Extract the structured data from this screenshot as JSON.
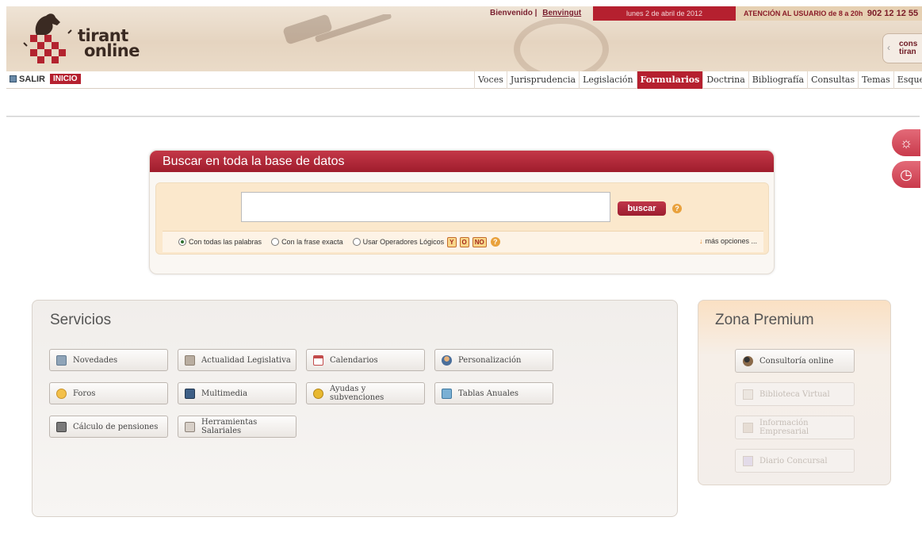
{
  "header": {
    "logo_lines": [
      "tirant",
      "online"
    ],
    "welcome_label": "Bienvenido |",
    "user_name": "Benvingut",
    "date": "lunes 2 de abril de 2012",
    "attention_label": "ATENCIÓN AL USUARIO de 8 a 20h",
    "phone": "902 12 12 55",
    "corner_tab": [
      "cons",
      "tiran"
    ]
  },
  "nav": {
    "salir": "SALIR",
    "inicio": "INICIO",
    "menu": [
      "Voces",
      "Jurisprudencia",
      "Legislación",
      "Formularios",
      "Doctrina",
      "Bibliografía",
      "Consultas",
      "Temas",
      "Esquema"
    ],
    "active_item": "Formularios"
  },
  "search": {
    "title": "Buscar en toda la base de datos",
    "query_value": "",
    "button": "buscar",
    "help_glyph": "?",
    "options": [
      {
        "label": "Con todas las palabras",
        "selected": true
      },
      {
        "label": "Con la frase exacta",
        "selected": false
      },
      {
        "label": "Usar Operadores Lógicos",
        "selected": false
      }
    ],
    "operators": [
      "Y",
      "O",
      "NO"
    ],
    "more_options": "más opciones ..."
  },
  "services": {
    "title": "Servicios",
    "items": [
      {
        "label": "Novedades",
        "icon": "document-icon"
      },
      {
        "label": "Actualidad Legislativa",
        "icon": "bank-icon"
      },
      {
        "label": "Calendarios",
        "icon": "calendar-icon"
      },
      {
        "label": "Personalización",
        "icon": "user-icon"
      },
      {
        "label": "Foros",
        "icon": "forum-icon"
      },
      {
        "label": "Multimedia",
        "icon": "multimedia-icon"
      },
      {
        "label": "Ayudas y subvenciones",
        "icon": "coins-icon"
      },
      {
        "label": "Tablas Anuales",
        "icon": "table-icon"
      },
      {
        "label": "Cálculo de pensiones",
        "icon": "calculator-icon"
      },
      {
        "label": "Herramientas Salariales",
        "icon": "tools-icon"
      }
    ]
  },
  "premium": {
    "title": "Zona Premium",
    "items": [
      {
        "label": "Consultoría online",
        "icon": "consultant-icon",
        "enabled": true
      },
      {
        "label": "Biblioteca Virtual",
        "icon": "book-icon",
        "enabled": false
      },
      {
        "label": "Información Empresarial",
        "icon": "building-icon",
        "enabled": false
      },
      {
        "label": "Diario Concursal",
        "icon": "chart-icon",
        "enabled": false
      }
    ]
  },
  "colors": {
    "brand_red": "#b5202f",
    "search_bg": "#fbe8cc",
    "accent_orange": "#e9a13c"
  }
}
